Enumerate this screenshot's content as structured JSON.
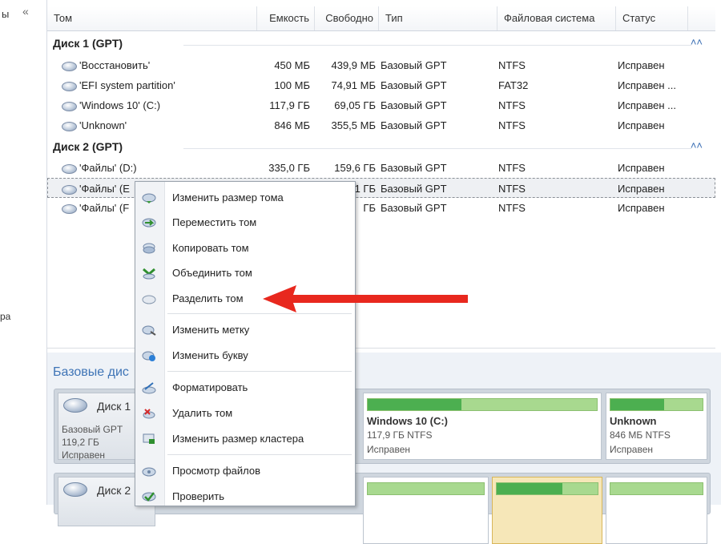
{
  "left_pane": {
    "text_top": "ы",
    "collapse_icon": "«",
    "text_mid": "ра"
  },
  "columns": [
    {
      "label": "Том"
    },
    {
      "label": "Емкость"
    },
    {
      "label": "Свободно"
    },
    {
      "label": "Тип"
    },
    {
      "label": "Файловая система"
    },
    {
      "label": "Статус"
    }
  ],
  "groups": [
    {
      "label": "Диск 1 (GPT)",
      "rows": [
        {
          "name": "'Восстановить'",
          "capacity": "450 МБ",
          "free": "439,9 МБ",
          "type": "Базовый GPT",
          "fs": "NTFS",
          "status": "Исправен"
        },
        {
          "name": "'EFI system partition'",
          "capacity": "100 МБ",
          "free": "74,91 МБ",
          "type": "Базовый GPT",
          "fs": "FAT32",
          "status": "Исправен ..."
        },
        {
          "name": "'Windows 10' (C:)",
          "capacity": "117,9 ГБ",
          "free": "69,05 ГБ",
          "type": "Базовый GPT",
          "fs": "NTFS",
          "status": "Исправен ..."
        },
        {
          "name": "'Unknown'",
          "capacity": "846 МБ",
          "free": "355,5 МБ",
          "type": "Базовый GPT",
          "fs": "NTFS",
          "status": "Исправен"
        }
      ]
    },
    {
      "label": "Диск 2 (GPT)",
      "rows": [
        {
          "name": "'Файлы' (D:)",
          "capacity": "335,0 ГБ",
          "free": "159,6 ГБ",
          "type": "Базовый GPT",
          "fs": "NTFS",
          "status": "Исправен"
        },
        {
          "name": "'Файлы' (E",
          "capacity": "",
          "free": "1 ГБ",
          "type": "Базовый GPT",
          "fs": "NTFS",
          "status": "Исправен"
        },
        {
          "name": "'Файлы' (F",
          "capacity": "",
          "free": "ГБ",
          "type": "Базовый GPT",
          "fs": "NTFS",
          "status": "Исправен"
        }
      ]
    }
  ],
  "context_menu": {
    "items": [
      {
        "label": "Изменить размер тома",
        "icon": "resize-volume-icon"
      },
      {
        "label": "Переместить том",
        "icon": "move-volume-icon"
      },
      {
        "label": "Копировать том",
        "icon": "copy-volume-icon"
      },
      {
        "label": "Объединить том",
        "icon": "merge-volume-icon"
      },
      {
        "label": "Разделить том",
        "icon": "split-volume-icon"
      },
      {
        "label": "Изменить метку",
        "icon": "change-label-icon"
      },
      {
        "label": "Изменить букву",
        "icon": "change-letter-icon"
      },
      {
        "label": "Форматировать",
        "icon": "format-icon"
      },
      {
        "label": "Удалить том",
        "icon": "delete-volume-icon"
      },
      {
        "label": "Изменить размер кластера",
        "icon": "cluster-size-icon"
      },
      {
        "label": "Просмотр файлов",
        "icon": "browse-files-icon"
      },
      {
        "label": "Проверить",
        "icon": "check-icon"
      }
    ]
  },
  "lower": {
    "title": "Базовые дис",
    "disk1": {
      "name": "Диск 1",
      "type": "Базовый GPT",
      "size": "119,2 ГБ",
      "status": "Исправен"
    },
    "disk2": {
      "name": "Диск 2"
    },
    "partitions": [
      {
        "name": "Windows 10 (C:)",
        "size": "117,9 ГБ NTFS",
        "status": "Исправен",
        "used_fraction": 0.41
      },
      {
        "name": "Unknown",
        "size": "846 МБ NTFS",
        "status": "Исправен",
        "used_fraction": 0.58
      }
    ]
  },
  "colors": {
    "accent_blue": "#3e74b6",
    "arrow_red": "#e8281e",
    "used_green": "#4caf50",
    "free_green": "#a8d98f"
  }
}
